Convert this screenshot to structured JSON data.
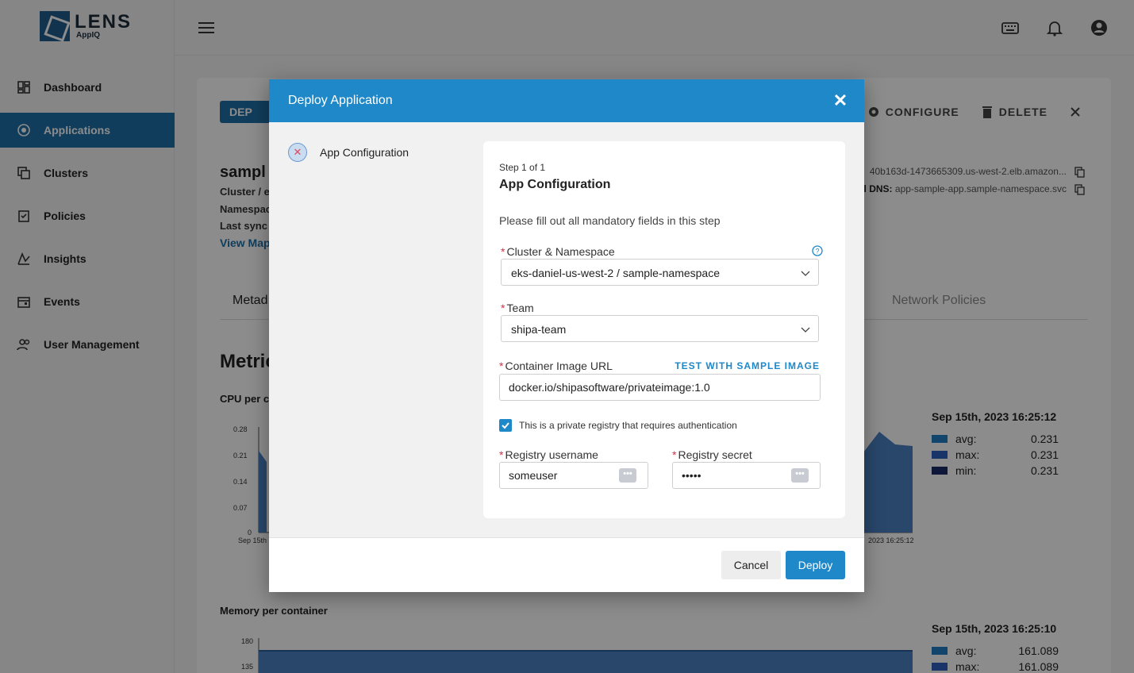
{
  "brand": {
    "name": "LENS",
    "sub": "AppIQ"
  },
  "sidebar": {
    "items": [
      {
        "label": "Dashboard",
        "icon": "dashboard-icon"
      },
      {
        "label": "Applications",
        "icon": "applications-icon",
        "active": true
      },
      {
        "label": "Clusters",
        "icon": "clusters-icon"
      },
      {
        "label": "Policies",
        "icon": "policies-icon"
      },
      {
        "label": "Insights",
        "icon": "insights-icon"
      },
      {
        "label": "Events",
        "icon": "events-icon"
      },
      {
        "label": "User Management",
        "icon": "users-icon"
      }
    ]
  },
  "topbar": {
    "icons": [
      "menu-icon",
      "keyboard-icon",
      "bell-icon",
      "account-icon"
    ]
  },
  "app": {
    "deploy_label": "DEP",
    "configure_label": "CONFIGURE",
    "delete_label": "DELETE",
    "name": "sampl",
    "cluster_label": "Cluster / e",
    "namespace_label": "Namespac",
    "last_sync_label": "Last sync",
    "view_map": "View Map",
    "dns1": "40b163d-1473665309.us-west-2.elb.amazon...",
    "dns2_label": "l DNS:",
    "dns2_value": "app-sample-app.sample-namespace.svc",
    "tab_metadata": "Metad",
    "tab_network": "Network Policies",
    "metrics_title": "Metric",
    "cpu_label": "CPU per c",
    "memory_label": "Memory per container",
    "cpu_ticks": [
      "0.28",
      "0.21",
      "0.14",
      "0.07",
      "0"
    ],
    "cpu_x_first": "Sep 15th",
    "cpu_x_last": "2023 16:25:12",
    "mem_ticks": [
      "180",
      "135"
    ],
    "cpu_legend": {
      "time": "Sep 15th, 2023 16:25:12",
      "rows": [
        {
          "name": "avg:",
          "value": "0.231",
          "color": "#1f7fc4"
        },
        {
          "name": "max:",
          "value": "0.231",
          "color": "#2f5fc0"
        },
        {
          "name": "min:",
          "value": "0.231",
          "color": "#1d2b66"
        }
      ]
    },
    "mem_legend": {
      "time": "Sep 15th, 2023 16:25:10",
      "rows": [
        {
          "name": "avg:",
          "value": "161.089",
          "color": "#1f7fc4"
        },
        {
          "name": "max:",
          "value": "161.089",
          "color": "#2f5fc0"
        }
      ]
    }
  },
  "modal": {
    "title": "Deploy Application",
    "step_nav_label": "App Configuration",
    "step_count": "Step 1 of 1",
    "form_title": "App Configuration",
    "hint": "Please fill out all mandatory fields in this step",
    "cluster_label": "Cluster & Namespace",
    "cluster_value": "eks-daniel-us-west-2 / sample-namespace",
    "team_label": "Team",
    "team_value": "shipa-team",
    "image_label": "Container Image URL",
    "sample_link": "TEST WITH SAMPLE IMAGE",
    "image_value": "docker.io/shipasoftware/privateimage:1.0",
    "private_checkbox_label": "This is a private registry that requires authentication",
    "username_label": "Registry username",
    "username_value": "someuser",
    "secret_label": "Registry secret",
    "secret_value": "•••••",
    "cancel_label": "Cancel",
    "deploy_label": "Deploy"
  }
}
